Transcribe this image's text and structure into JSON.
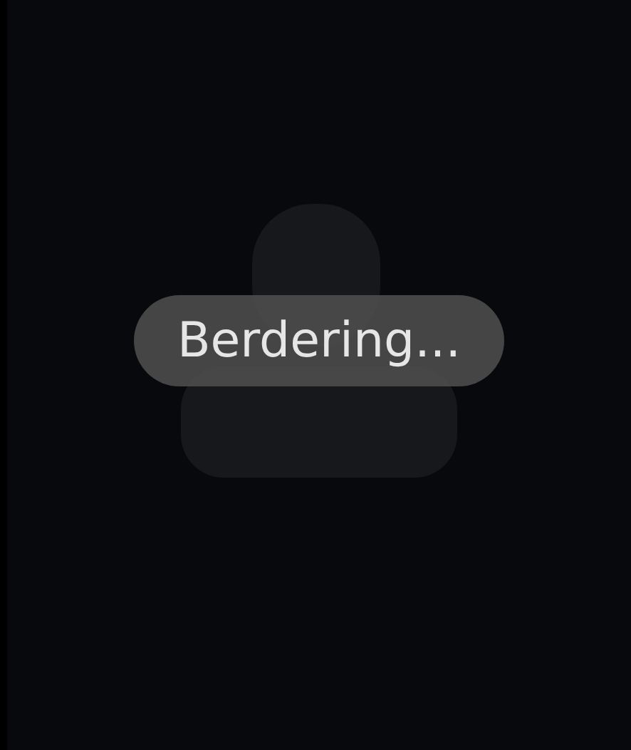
{
  "call_status": {
    "label": "Berdering..."
  }
}
